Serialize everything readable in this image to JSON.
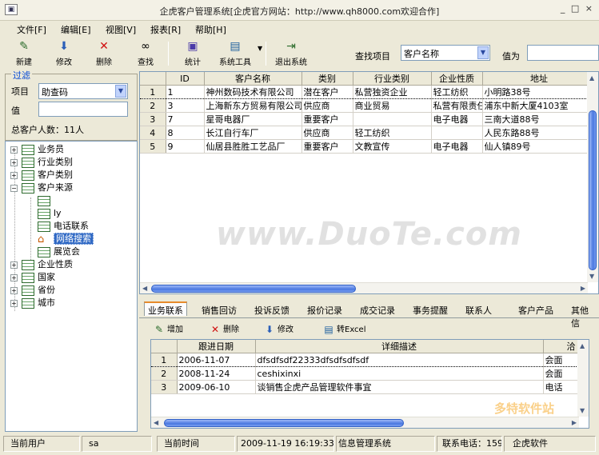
{
  "window": {
    "title": "企虎客户管理系统[企虎官方网站：http://www.qh8000.com欢迎合作]",
    "controls": "_ □ ×"
  },
  "menu": [
    "文件[F]",
    "编辑[E]",
    "视图[V]",
    "报表[R]",
    "帮助[H]"
  ],
  "toolbar": {
    "new": "新建",
    "edit": "修改",
    "delete": "删除",
    "find": "查找",
    "stats": "统计",
    "tools": "系统工具",
    "exit": "退出系统",
    "find_item_label": "查找项目",
    "find_item_value": "客户名称",
    "value_label": "值为",
    "value_input": ""
  },
  "filter": {
    "title": "过滤",
    "item_label": "项目",
    "item_value": "助查码",
    "value_label": "值",
    "value_input": "",
    "total": "总客户人数：11人"
  },
  "tree": {
    "business_staff": "业务员",
    "industry": "行业类别",
    "customer_type": "客户类别",
    "customer_source": "客户来源",
    "source_children": [
      "",
      "ly",
      "电话联系",
      "网络搜索",
      "展览会"
    ],
    "selected_child": "网络搜索",
    "company_nature": "企业性质",
    "country": "国家",
    "province": "省份",
    "city": "城市"
  },
  "customers": {
    "columns": [
      "ID",
      "客户名称",
      "类别",
      "行业类别",
      "企业性质",
      "地址"
    ],
    "rows": [
      {
        "rn": "1",
        "id": "1",
        "name": "神州数码技术有限公司",
        "type": "潜在客户",
        "industry": "私营独资企业",
        "nature": "轻工纺织",
        "address": "小明路38号"
      },
      {
        "rn": "2",
        "id": "3",
        "name": "上海新东方贸易有限公司",
        "type": "供应商",
        "industry": "商业贸易",
        "nature": "私营有限责任",
        "address": "浦东中新大厦4103室"
      },
      {
        "rn": "3",
        "id": "7",
        "name": "星哥电器厂",
        "type": "重要客户",
        "industry": "",
        "nature": "电子电器",
        "address": "三南大道88号"
      },
      {
        "rn": "4",
        "id": "8",
        "name": "长江自行车厂",
        "type": "供应商",
        "industry": "轻工纺织",
        "nature": "",
        "address": "人民东路88号"
      },
      {
        "rn": "5",
        "id": "9",
        "name": "仙居县胜胜工艺品厂",
        "type": "重要客户",
        "industry": "文教宣传",
        "nature": "电子电器",
        "address": "仙人镇89号"
      }
    ]
  },
  "tabs": [
    "业务联系",
    "销售回访",
    "投诉反馈",
    "报价记录",
    "成交记录",
    "事务提醒",
    "联系人",
    "客户产品",
    "其他信"
  ],
  "active_tab": "业务联系",
  "subtoolbar": {
    "add": "增加",
    "delete": "删除",
    "edit": "修改",
    "excel": "转Excel"
  },
  "followups": {
    "columns": [
      "跟进日期",
      "详细描述",
      "洽"
    ],
    "rows": [
      {
        "rn": "1",
        "date": "2006-11-07",
        "desc": "dfsdfsdf22333dfsdfsdfsdf",
        "way": "会面"
      },
      {
        "rn": "2",
        "date": "2008-11-24",
        "desc": "ceshixinxi",
        "way": "会面"
      },
      {
        "rn": "3",
        "date": "2009-06-10",
        "desc": "谈销售企虎产品管理软件事宜",
        "way": "电话"
      }
    ]
  },
  "status": {
    "user_label": "当前用户",
    "user": "sa",
    "time_label": "当前时间",
    "time": "2009-11-19 16:19:33",
    "system": "信息管理系统",
    "phone": "联系电话：159",
    "company": "企虎软件"
  },
  "watermark": "www.DuoTe.com",
  "watermark2": "多特软件站"
}
